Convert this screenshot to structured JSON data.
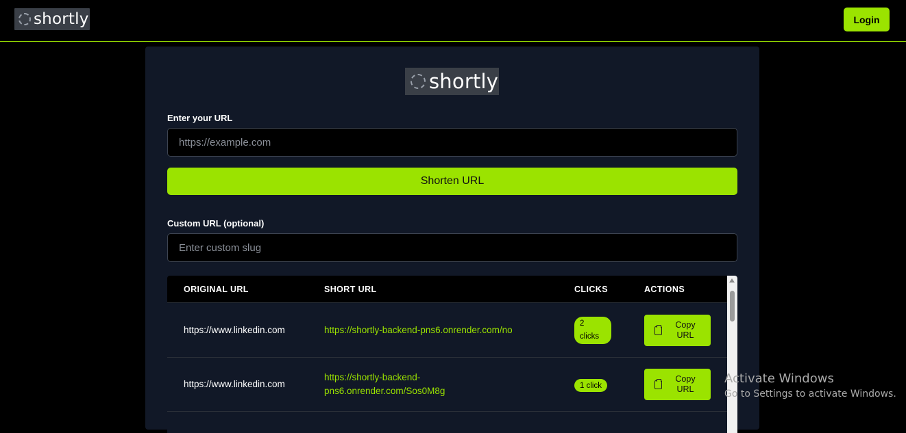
{
  "header": {
    "logo_text": "shortly",
    "login_label": "Login"
  },
  "card": {
    "logo_text": "shortly",
    "url_label": "Enter your URL",
    "url_placeholder": "https://example.com",
    "url_value": "",
    "shorten_label": "Shorten URL",
    "custom_label": "Custom URL (optional)",
    "custom_placeholder": "Enter custom slug",
    "custom_value": ""
  },
  "table": {
    "headers": [
      "ORIGINAL URL",
      "SHORT URL",
      "CLICKS",
      "ACTIONS"
    ],
    "rows": [
      {
        "original": "https://www.linkedin.com",
        "short_line1": "https://shortly-backend-pns6.onrender.com/no",
        "short_line2": "",
        "clicks": "2 clicks",
        "action": "Copy URL"
      },
      {
        "original": "https://www.linkedin.com",
        "short_line1": "https://shortly-backend-",
        "short_line2": "pns6.onrender.com/Sos0M8g",
        "clicks": "1 click",
        "action": "Copy URL"
      }
    ]
  },
  "watermark": {
    "title": "Activate Windows",
    "subtitle": "Go to Settings to activate Windows."
  },
  "colors": {
    "accent": "#9be300",
    "card_bg": "#111827",
    "page_bg": "#000000"
  }
}
